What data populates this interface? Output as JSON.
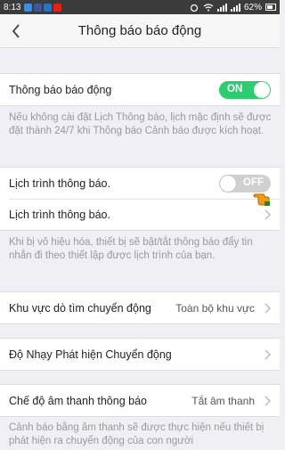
{
  "status_bar": {
    "time": "8:13",
    "app_icons": [
      {
        "name": "messenger-icon",
        "color": "#3a8ee6"
      },
      {
        "name": "facebook-icon",
        "color": "#3b5998"
      },
      {
        "name": "mail-icon",
        "color": "#2a72c9"
      },
      {
        "name": "youtube-icon",
        "color": "#e62117"
      }
    ],
    "battery": "62%"
  },
  "header": {
    "title": "Thông báo báo động"
  },
  "alarm_notification": {
    "label": "Thông báo báo động",
    "toggle": "ON"
  },
  "note1": "Nếu không cài đặt Lịch Thông báo, lịch mặc định sẽ được đặt thành 24/7 khi Thông báo Cảnh báo được kích hoạt.",
  "schedule": {
    "toggle_label": "Lịch trình thông báo.",
    "toggle": "OFF",
    "link_label": "Lịch trình thông báo."
  },
  "note2": "Khi bị vô hiệu hóa, thiết bị sẽ bật/tắt thông báo đẩy tin nhắn đi theo thiết lập được lịch trình của bạn.",
  "motion_zone": {
    "label": "Khu vực dò tìm chuyển động",
    "value": "Toàn bộ khu vực"
  },
  "sensitivity": {
    "label": "Độ Nhạy Phát hiện Chuyển động"
  },
  "sound_mode": {
    "label": "Chế độ âm thanh thông báo",
    "value": "Tắt âm thanh"
  },
  "note3": "Cảnh báo bằng âm thanh sẽ được thực hiện nếu thiết bị phát hiện ra chuyển động của con người",
  "colors": {
    "accent_on": "#2ecc71",
    "toggle_off": "#d0d0d0",
    "hint_hand": "#f39c12"
  }
}
